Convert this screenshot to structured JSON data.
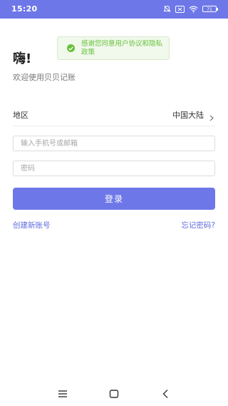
{
  "status_bar": {
    "time": "15:20",
    "battery": "71",
    "background_color": "#6e77e8"
  },
  "toast": {
    "message": "感谢您同意用户协议和隐私政策",
    "icon": "check-circle-icon",
    "color": "#67c23a"
  },
  "header": {
    "greeting": "嗨!",
    "welcome": "欢迎使用贝贝记账"
  },
  "region": {
    "label": "地区",
    "value": "中国大陆"
  },
  "form": {
    "phone_placeholder": "输入手机号或邮箱",
    "phone_value": "",
    "password_placeholder": "密码",
    "password_value": "",
    "login_label": "登录"
  },
  "links": {
    "create_account": "创建新账号",
    "forgot_password": "忘记密码?"
  },
  "nav_bar": {
    "icons": [
      "menu-icon",
      "home-square-icon",
      "back-icon"
    ]
  },
  "colors": {
    "accent": "#6e77e8",
    "link": "#5f6be0",
    "success": "#67c23a"
  }
}
